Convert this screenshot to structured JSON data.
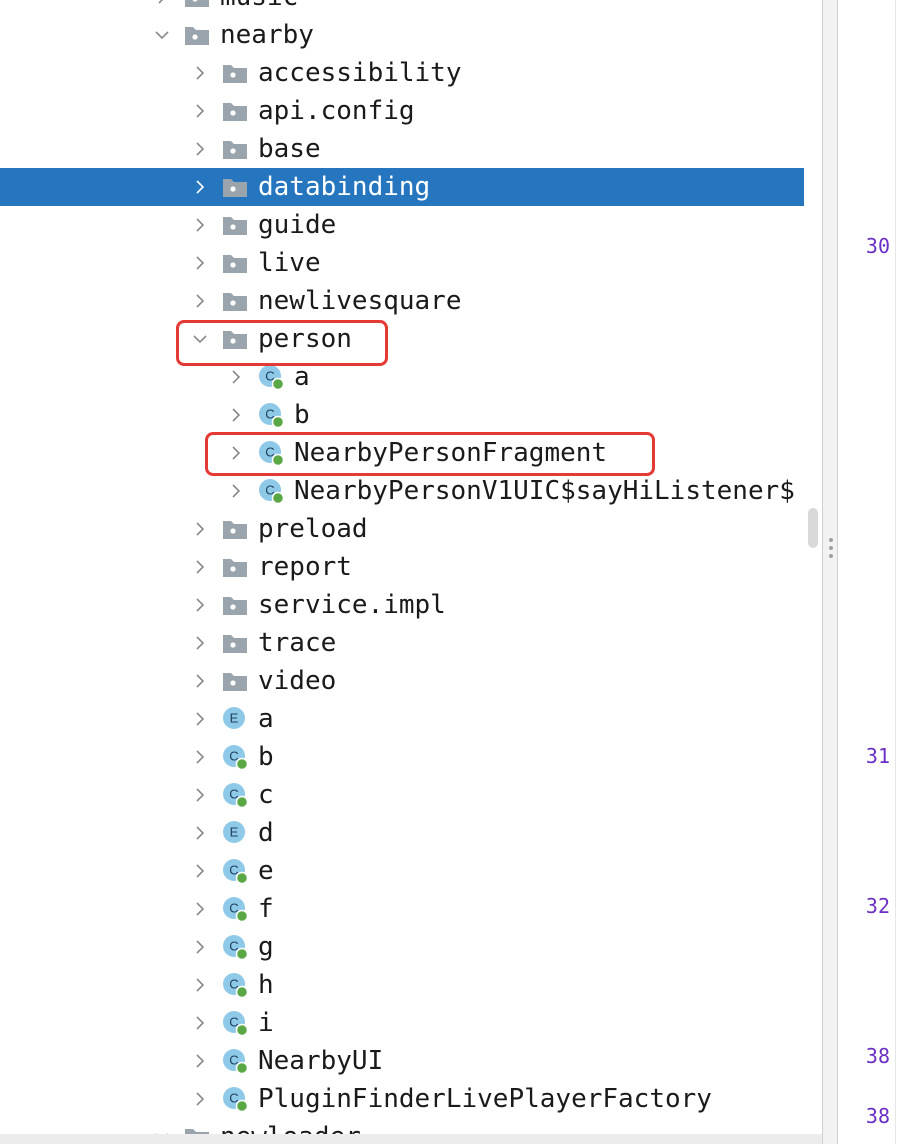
{
  "project_tree": {
    "rows": [
      {
        "label": "music",
        "kind": "folder",
        "depth": 0,
        "state": "collapsed"
      },
      {
        "label": "nearby",
        "kind": "folder",
        "depth": 0,
        "state": "expanded"
      },
      {
        "label": "accessibility",
        "kind": "folder",
        "depth": 1,
        "state": "collapsed"
      },
      {
        "label": "api.config",
        "kind": "folder",
        "depth": 1,
        "state": "collapsed"
      },
      {
        "label": "base",
        "kind": "folder",
        "depth": 1,
        "state": "collapsed"
      },
      {
        "label": "databinding",
        "kind": "folder",
        "depth": 1,
        "state": "collapsed",
        "selected": true
      },
      {
        "label": "guide",
        "kind": "folder",
        "depth": 1,
        "state": "collapsed"
      },
      {
        "label": "live",
        "kind": "folder",
        "depth": 1,
        "state": "collapsed"
      },
      {
        "label": "newlivesquare",
        "kind": "folder",
        "depth": 1,
        "state": "collapsed"
      },
      {
        "label": "person",
        "kind": "folder",
        "depth": 1,
        "state": "expanded"
      },
      {
        "label": "a",
        "kind": "class",
        "depth": 2,
        "state": "collapsed"
      },
      {
        "label": "b",
        "kind": "class",
        "depth": 2,
        "state": "collapsed"
      },
      {
        "label": "NearbyPersonFragment",
        "kind": "class",
        "depth": 2,
        "state": "collapsed"
      },
      {
        "label": "NearbyPersonV1UIC$sayHiListener$",
        "kind": "class",
        "depth": 2,
        "state": "collapsed"
      },
      {
        "label": "preload",
        "kind": "folder",
        "depth": 1,
        "state": "collapsed"
      },
      {
        "label": "report",
        "kind": "folder",
        "depth": 1,
        "state": "collapsed"
      },
      {
        "label": "service.impl",
        "kind": "folder",
        "depth": 1,
        "state": "collapsed"
      },
      {
        "label": "trace",
        "kind": "folder",
        "depth": 1,
        "state": "collapsed"
      },
      {
        "label": "video",
        "kind": "folder",
        "depth": 1,
        "state": "collapsed"
      },
      {
        "label": "a",
        "kind": "enum",
        "depth": 1,
        "state": "collapsed"
      },
      {
        "label": "b",
        "kind": "class",
        "depth": 1,
        "state": "collapsed"
      },
      {
        "label": "c",
        "kind": "class",
        "depth": 1,
        "state": "collapsed"
      },
      {
        "label": "d",
        "kind": "enum",
        "depth": 1,
        "state": "collapsed"
      },
      {
        "label": "e",
        "kind": "class",
        "depth": 1,
        "state": "collapsed"
      },
      {
        "label": "f",
        "kind": "class",
        "depth": 1,
        "state": "collapsed"
      },
      {
        "label": "g",
        "kind": "class",
        "depth": 1,
        "state": "collapsed"
      },
      {
        "label": "h",
        "kind": "class",
        "depth": 1,
        "state": "collapsed"
      },
      {
        "label": "i",
        "kind": "class",
        "depth": 1,
        "state": "collapsed"
      },
      {
        "label": "NearbyUI",
        "kind": "class",
        "depth": 1,
        "state": "collapsed"
      },
      {
        "label": "PluginFinderLivePlayerFactory",
        "kind": "class",
        "depth": 1,
        "state": "collapsed"
      },
      {
        "label": "newloader",
        "kind": "folder",
        "depth": 0,
        "state": "expanded"
      }
    ]
  },
  "editor_gutter": {
    "line_numbers": [
      "30",
      "31",
      "32",
      "38",
      "38"
    ]
  },
  "icon_letters": {
    "class": "C",
    "enum": "E"
  },
  "colors": {
    "selection": "#2675bf",
    "folder_icon": "#9aa4ad",
    "class_icon": "#8fc9e8",
    "run_badge": "#5aa745",
    "line_number": "#6a2fc4",
    "annotation_box": "#e53935"
  }
}
